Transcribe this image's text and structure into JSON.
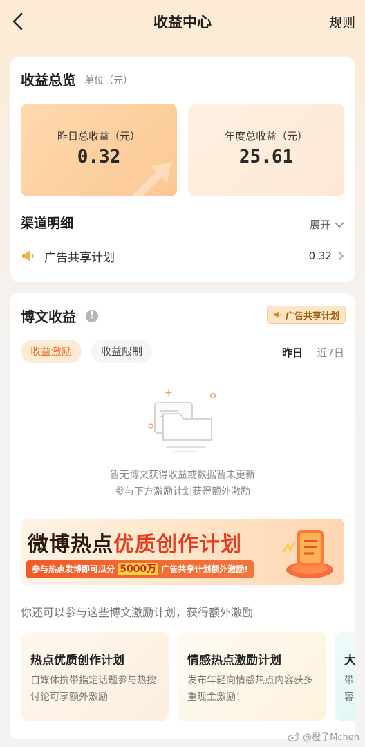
{
  "header": {
    "title": "收益中心",
    "rules_label": "规则"
  },
  "overview": {
    "title": "收益总览",
    "unit": "单位（元）",
    "yesterday_label": "昨日总收益（元）",
    "yesterday_value": "0.32",
    "year_label": "年度总收益（元）",
    "year_value": "25.61"
  },
  "channels": {
    "title": "渠道明细",
    "expand_label": "展开",
    "items": [
      {
        "name": "广告共享计划",
        "value": "0.32"
      }
    ]
  },
  "post_earnings": {
    "title": "博文收益",
    "info_glyph": "!",
    "badge": "广告共享计划",
    "tabs": [
      "收益激励",
      "收益限制"
    ],
    "periods": [
      "昨日",
      "近7日"
    ],
    "empty_line1": "暂无博文获得收益或数据暂未更新",
    "empty_line2": "参与下方激励计划获得额外激励"
  },
  "banner": {
    "title_part1": "微博热点",
    "title_part2": "优质创作计划",
    "strip_part1": "参与热点发博即可瓜分",
    "strip_highlight": "5000万",
    "strip_part2": "广告共享计划额外激励!"
  },
  "more": {
    "text": "你还可以参与这些博文激励计划，获得额外激励",
    "plans": [
      {
        "title": "热点优质创作计划",
        "desc": "自媒体携带指定话题参与热搜讨论可享额外激励"
      },
      {
        "title": "情感热点激励计划",
        "desc": "发布年轻向情感热点内容获多重现金激励！"
      },
      {
        "title": "大",
        "desc": "带容"
      }
    ]
  },
  "watermark": "@橙子Mchen",
  "colors": {
    "accent": "#e8732c",
    "banner_red": "#e23d1f",
    "badge_text": "#9a5a10"
  }
}
